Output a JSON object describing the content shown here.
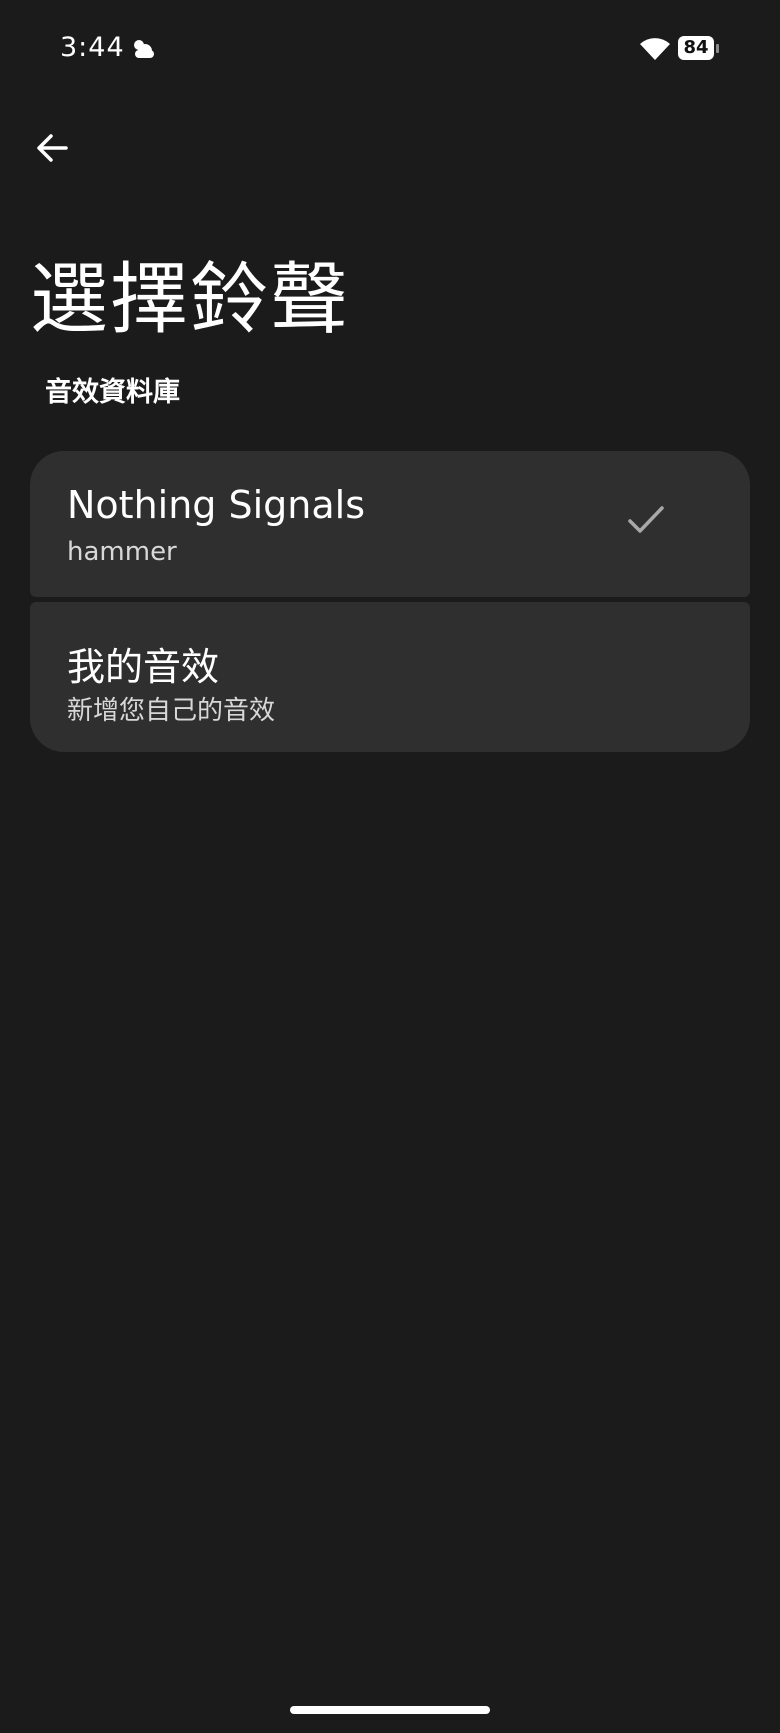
{
  "status_bar": {
    "time": "3:44",
    "battery_level": "84",
    "icons": [
      "weather-cloud-icon",
      "wifi-icon",
      "battery-icon"
    ]
  },
  "header": {
    "back_icon": "arrow-left-icon",
    "title": "選擇鈴聲"
  },
  "section": {
    "label": "音效資料庫"
  },
  "list": {
    "items": [
      {
        "title": "Nothing Signals",
        "subtitle": "hammer",
        "selected": true
      },
      {
        "title": "我的音效",
        "subtitle": "新增您自己的音效",
        "selected": false
      }
    ]
  },
  "colors": {
    "background": "#1b1b1b",
    "card": "#2f2f2f",
    "text": "#ffffff",
    "check": "#a8a8a8"
  }
}
